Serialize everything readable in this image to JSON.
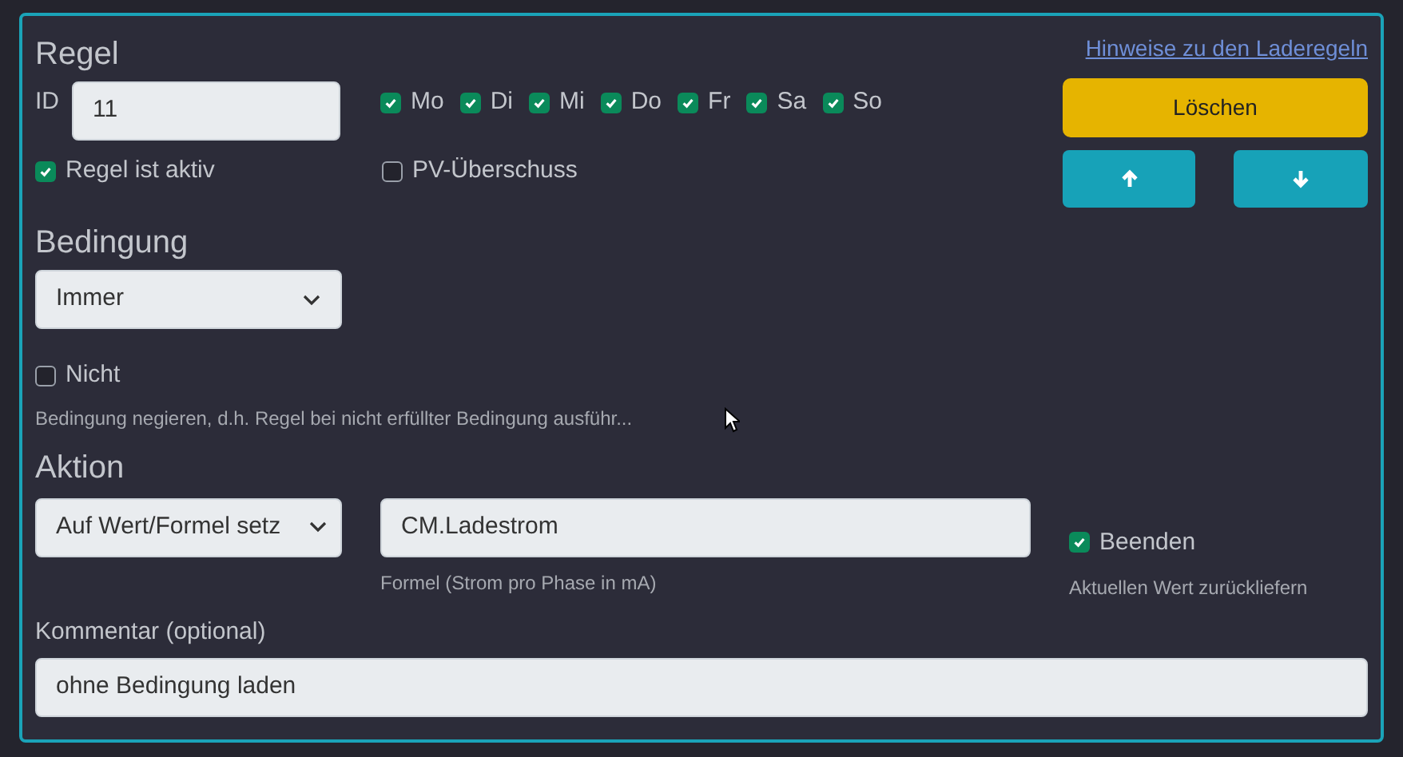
{
  "rule": {
    "title": "Regel",
    "help_link": "Hinweise zu den Laderegeln",
    "id_label": "ID",
    "id_value": "11",
    "days": [
      {
        "label": "Mo",
        "checked": true
      },
      {
        "label": "Di",
        "checked": true
      },
      {
        "label": "Mi",
        "checked": true
      },
      {
        "label": "Do",
        "checked": true
      },
      {
        "label": "Fr",
        "checked": true
      },
      {
        "label": "Sa",
        "checked": true
      },
      {
        "label": "So",
        "checked": true
      }
    ],
    "active": {
      "label": "Regel ist aktiv",
      "checked": true
    },
    "pv_surplus": {
      "label": "PV-Überschuss",
      "checked": false
    },
    "delete_button": "Löschen"
  },
  "condition": {
    "title": "Bedingung",
    "select": "Immer",
    "negate": {
      "label": "Nicht",
      "checked": false
    },
    "hint": "Bedingung negieren, d.h. Regel bei nicht erfüllter Bedingung ausführ..."
  },
  "action": {
    "title": "Aktion",
    "select": "Auf Wert/Formel setz",
    "formula": "CM.Ladestrom",
    "formula_hint": "Formel (Strom pro Phase in mA)",
    "finish": {
      "label": "Beenden",
      "checked": true
    },
    "finish_hint": "Aktuellen Wert zurückliefern"
  },
  "comment": {
    "label": "Kommentar (optional)",
    "value": "ohne Bedingung laden"
  }
}
